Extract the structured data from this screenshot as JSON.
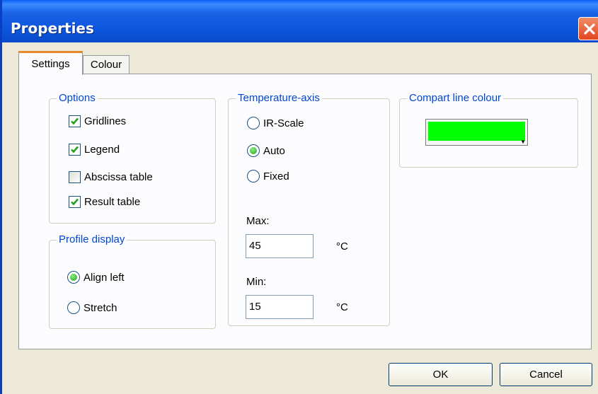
{
  "window": {
    "title": "Properties"
  },
  "tabs": [
    {
      "label": "Settings"
    },
    {
      "label": "Colour"
    }
  ],
  "options": {
    "legend": "Options",
    "items": [
      {
        "label": "Gridlines",
        "checked": true
      },
      {
        "label": "Legend",
        "checked": true
      },
      {
        "label": "Abscissa table",
        "checked": false
      },
      {
        "label": "Result table",
        "checked": true
      }
    ]
  },
  "profile_display": {
    "legend": "Profile display",
    "items": [
      {
        "label": "Align left",
        "selected": true
      },
      {
        "label": "Stretch",
        "selected": false
      }
    ]
  },
  "temperature_axis": {
    "legend": "Temperature-axis",
    "items": [
      {
        "label": "IR-Scale",
        "selected": false
      },
      {
        "label": "Auto",
        "selected": true
      },
      {
        "label": "Fixed",
        "selected": false
      }
    ],
    "max_label": "Max:",
    "max_value": "45",
    "max_unit": "°C",
    "min_label": "Min:",
    "min_value": "15",
    "min_unit": "°C"
  },
  "compart_line": {
    "legend": "Compart line colour",
    "color": "#00ff00"
  },
  "buttons": {
    "ok": "OK",
    "cancel": "Cancel"
  }
}
